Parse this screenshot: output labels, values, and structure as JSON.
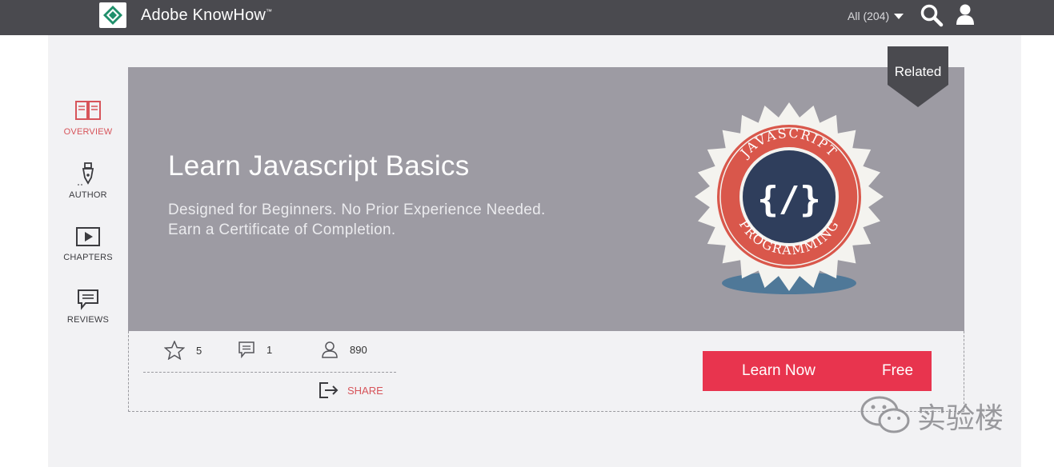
{
  "header": {
    "brand": "Adobe",
    "brand_product": " KnowHow",
    "brand_tm": "™",
    "filter_label": "All (204)"
  },
  "sidebar": {
    "items": [
      {
        "label": "OVERVIEW",
        "icon": "book-icon",
        "active": true
      },
      {
        "label": "AUTHOR",
        "icon": "pen-nib-icon",
        "active": false
      },
      {
        "label": "CHAPTERS",
        "icon": "play-icon",
        "active": false
      },
      {
        "label": "REVIEWS",
        "icon": "comment-icon",
        "active": false
      }
    ]
  },
  "hero": {
    "title": "Learn Javascript Basics",
    "subtitle_line1": "Designed for Beginners. No Prior Experience Needed.",
    "subtitle_line2": "Earn a Certificate of Completion.",
    "badge_top": "JAVASCRIPT",
    "badge_bottom": "PROGRAMMING",
    "badge_symbol": "{/}",
    "related_label": "Related"
  },
  "stats": {
    "rating": "5",
    "comments": "1",
    "learners": "890",
    "share_label": "SHARE"
  },
  "cta": {
    "label": "Learn Now",
    "price": "Free"
  },
  "watermark": {
    "text": "实验楼"
  },
  "colors": {
    "topbar": "#4a4a4f",
    "hero": "#9d9ba3",
    "accent": "#e8344e",
    "active": "#d7545a",
    "badge_red": "#d9574b",
    "badge_navy": "#2f3e5c"
  }
}
